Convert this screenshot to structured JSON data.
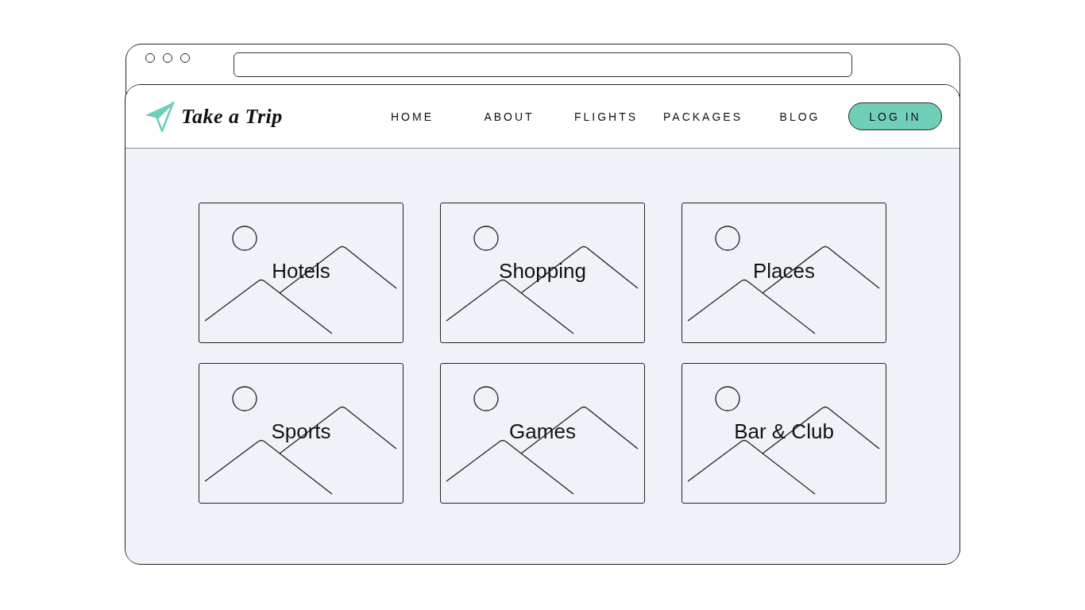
{
  "header": {
    "logo": {
      "text": "Take a Trip"
    },
    "nav": [
      "HOME",
      "ABOUT",
      "FLIGHTS",
      "PACKAGES",
      "BLOG"
    ],
    "login_button": {
      "label": "LOG IN"
    }
  },
  "categories": [
    {
      "title": "Hotels"
    },
    {
      "title": "Shopping"
    },
    {
      "title": "Places"
    },
    {
      "title": "Sports"
    },
    {
      "title": "Games"
    },
    {
      "title": "Bar & Club"
    }
  ]
}
